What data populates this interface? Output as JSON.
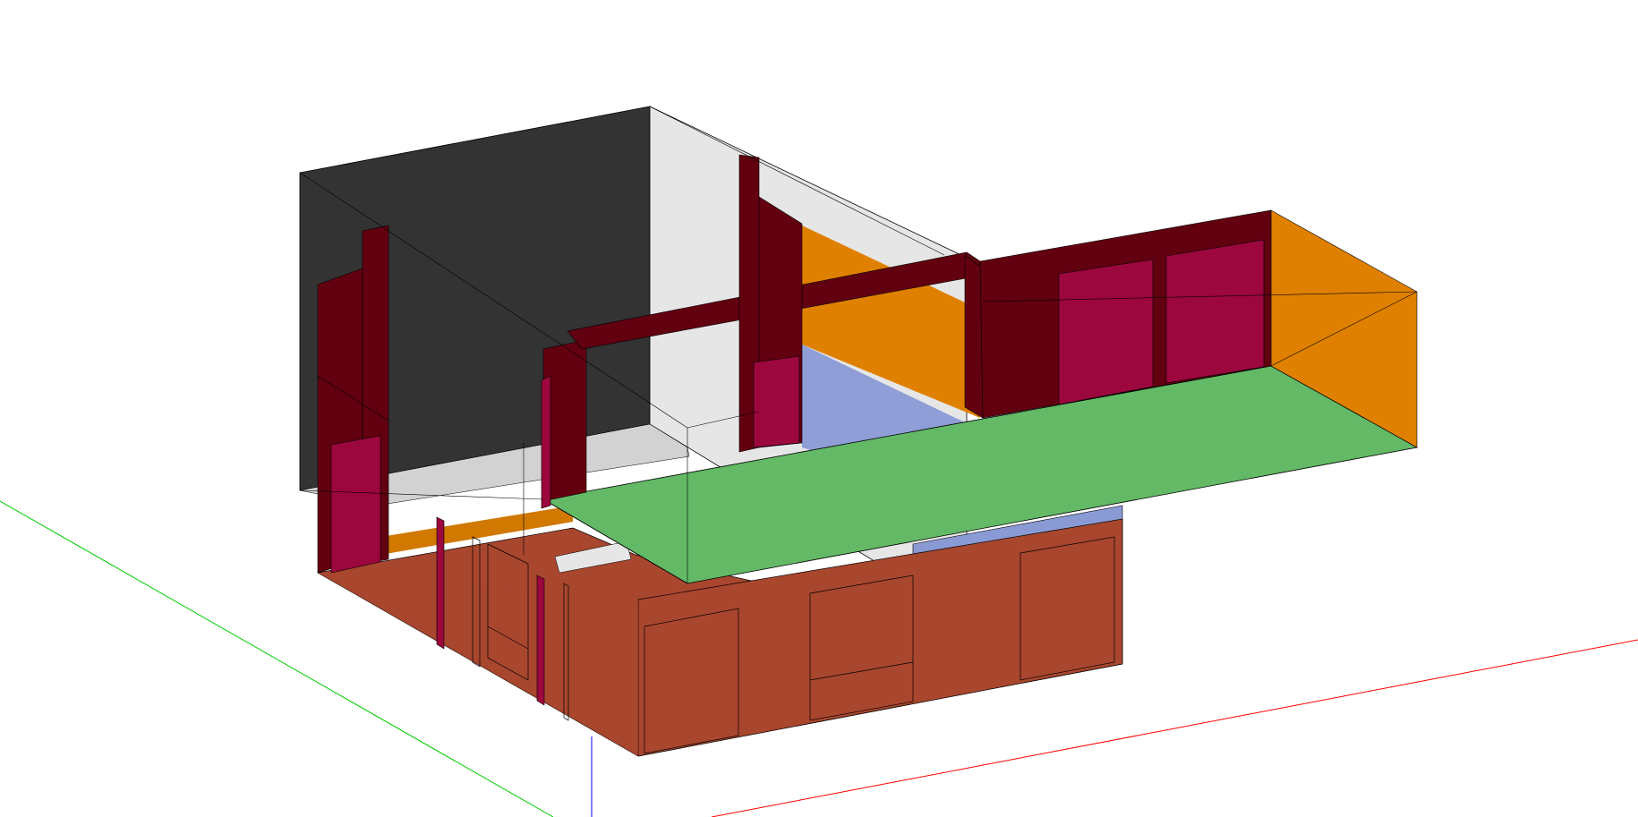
{
  "viewport": {
    "background": "#ffffff",
    "projection": "isometric",
    "view": "3d-model"
  },
  "axes": {
    "x_color": "#ff0000",
    "y_color": "#00cc00",
    "z_color": "#0000ff"
  },
  "materials": {
    "dark_wall": "#333333",
    "light_wall": "#e6e6e6",
    "wall_shade": "#d2d2d2",
    "frame": "#620010",
    "window": "#9c073d",
    "orange_wall": "#e08000",
    "green_roof": "#63b966",
    "blue_wall": "#8a9ad5",
    "brick_floor": "#a9462e",
    "edge": "#000000"
  }
}
